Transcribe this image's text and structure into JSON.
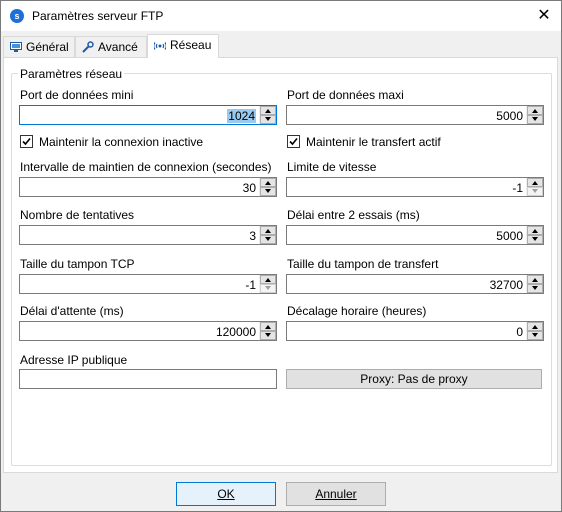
{
  "window": {
    "title": "Paramètres serveur FTP"
  },
  "tabs": [
    {
      "label": "Général",
      "icon": "monitor-icon"
    },
    {
      "label": "Avancé",
      "icon": "wrench-icon"
    },
    {
      "label": "Réseau",
      "icon": "network-icon"
    }
  ],
  "active_tab": "Réseau",
  "group": {
    "legend": "Paramètres réseau"
  },
  "fields": {
    "port_min": {
      "label": "Port de données mini",
      "value": "1024"
    },
    "port_max": {
      "label": "Port de données maxi",
      "value": "5000"
    },
    "keepalive": {
      "label": "Maintenir la connexion inactive",
      "checked": true
    },
    "keep_transfer": {
      "label": "Maintenir le transfert actif",
      "checked": true
    },
    "keepalive_interval": {
      "label": "Intervalle de maintien de connexion (secondes)",
      "value": "30"
    },
    "speed_limit": {
      "label": "Limite de vitesse",
      "value": "-1"
    },
    "retries": {
      "label": "Nombre de tentatives",
      "value": "3"
    },
    "retry_delay": {
      "label": "Délai entre 2 essais (ms)",
      "value": "5000"
    },
    "tcp_buffer": {
      "label": "Taille du tampon TCP",
      "value": "-1"
    },
    "transfer_buffer": {
      "label": "Taille du tampon de transfert",
      "value": "32700"
    },
    "timeout": {
      "label": "Délai d'attente (ms)",
      "value": "120000"
    },
    "time_offset": {
      "label": "Décalage horaire (heures)",
      "value": "0"
    },
    "public_ip": {
      "label": "Adresse IP publique",
      "value": ""
    }
  },
  "proxy_button": {
    "label": "Proxy: Pas de proxy"
  },
  "footer": {
    "ok_label": "OK",
    "cancel_label": "Annuler"
  },
  "colors": {
    "accent": "#0078d7",
    "selection": "#99c9ef"
  }
}
